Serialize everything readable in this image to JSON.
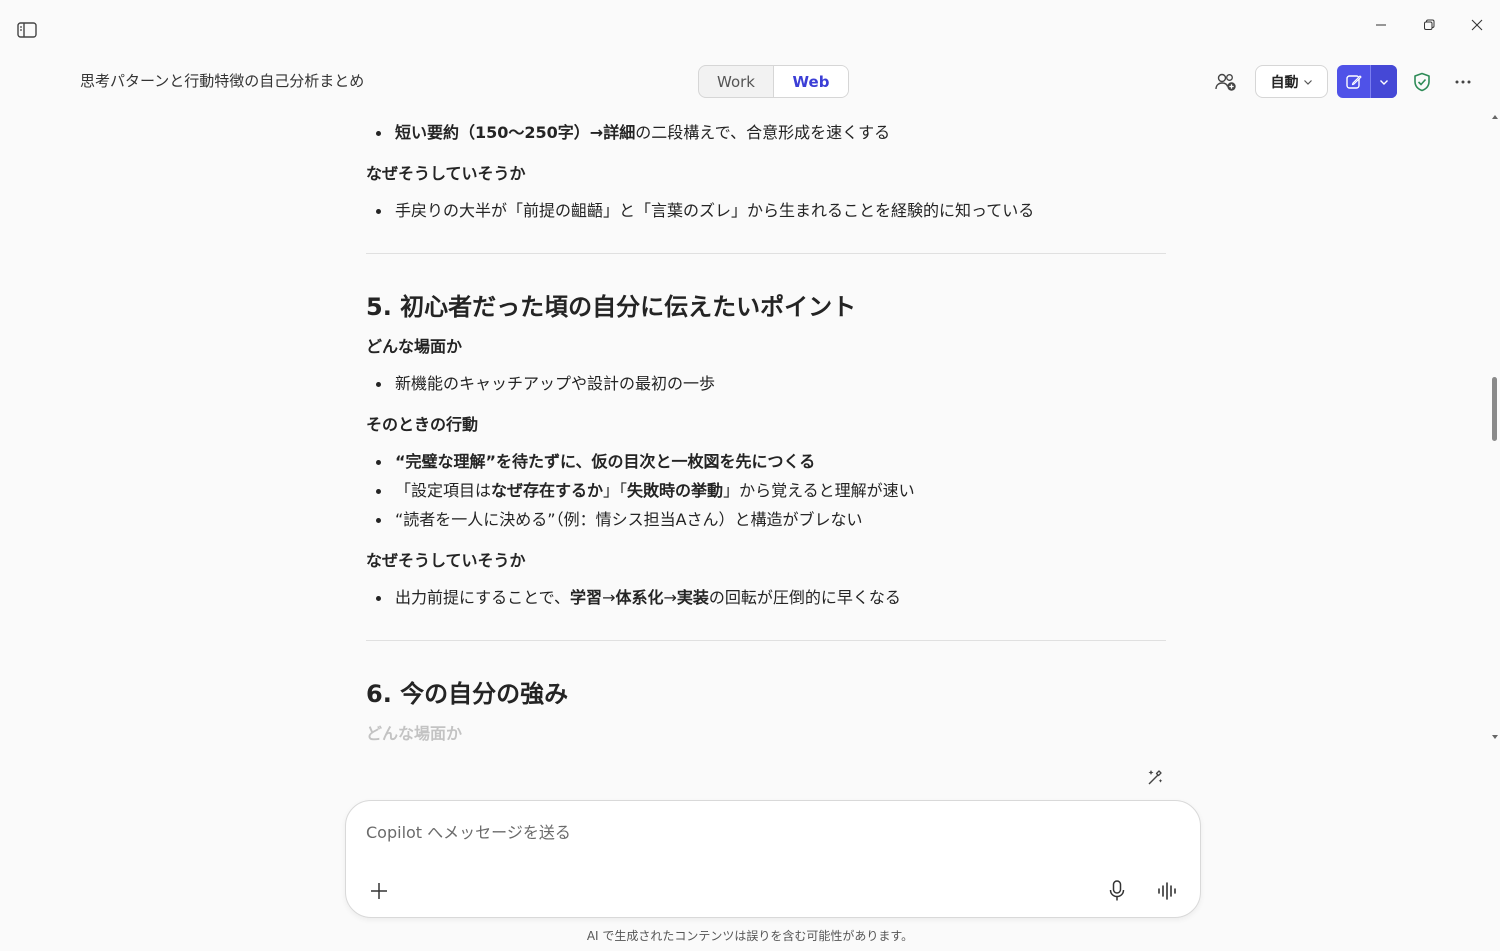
{
  "header": {
    "conversation_title": "思考パターンと行動特徴の自己分析まとめ",
    "mode_work": "Work",
    "mode_web": "Web",
    "auto_label": "自動"
  },
  "content": {
    "sec4_tail_bullet_bold": "短い要約（150〜250字）→詳細",
    "sec4_tail_bullet_rest": "の二段構えで、合意形成を速くする",
    "sec4_why_heading": "なぜそうしていそうか",
    "sec4_why_bullet": "手戻りの大半が「前提の齟齬」と「言葉のズレ」から生まれることを経験的に知っている",
    "sec5_title": "5. 初心者だった頃の自分に伝えたいポイント",
    "sec5_scene_heading": "どんな場面か",
    "sec5_scene_bullet": "新機能のキャッチアップや設計の最初の一歩",
    "sec5_action_heading": "そのときの行動",
    "sec5_action_b1": "“完璧な理解”を待たずに、仮の目次と一枚図を先につくる",
    "sec5_action_b2_pre": "「設定項目は",
    "sec5_action_b2_bold1": "なぜ存在するか",
    "sec5_action_b2_mid": "」「",
    "sec5_action_b2_bold2": "失敗時の挙動",
    "sec5_action_b2_post": "」から覚えると理解が速い",
    "sec5_action_b3": "“読者を一人に決める”（例：情シス担当Aさん）と構造がブレない",
    "sec5_why_heading": "なぜそうしていそうか",
    "sec5_why_pre": "出力前提にすることで、",
    "sec5_why_bold1": "学習",
    "sec5_why_arrow1": "→",
    "sec5_why_bold2": "体系化",
    "sec5_why_arrow2": "→",
    "sec5_why_bold3": "実装",
    "sec5_why_post": "の回転が圧倒的に早くなる",
    "sec6_title": "6. 今の自分の強み",
    "sec6_partial": "どんな場面か"
  },
  "composer": {
    "placeholder": "Copilot へメッセージを送る"
  },
  "footer": {
    "disclaimer": "AI で生成されたコンテンツは誤りを含む可能性があります。"
  },
  "colors": {
    "accent": "#4f52e8",
    "web_active_text": "#3b3ed6",
    "shield": "#2e8b57"
  },
  "icons": [
    "sidebar-toggle-icon",
    "minimize-icon",
    "restore-icon",
    "close-icon",
    "people-add-icon",
    "chevron-down-icon",
    "compose-icon",
    "shield-check-icon",
    "more-icon",
    "rewrite-sparkle-icon",
    "plus-icon",
    "microphone-icon",
    "voice-wave-icon"
  ]
}
